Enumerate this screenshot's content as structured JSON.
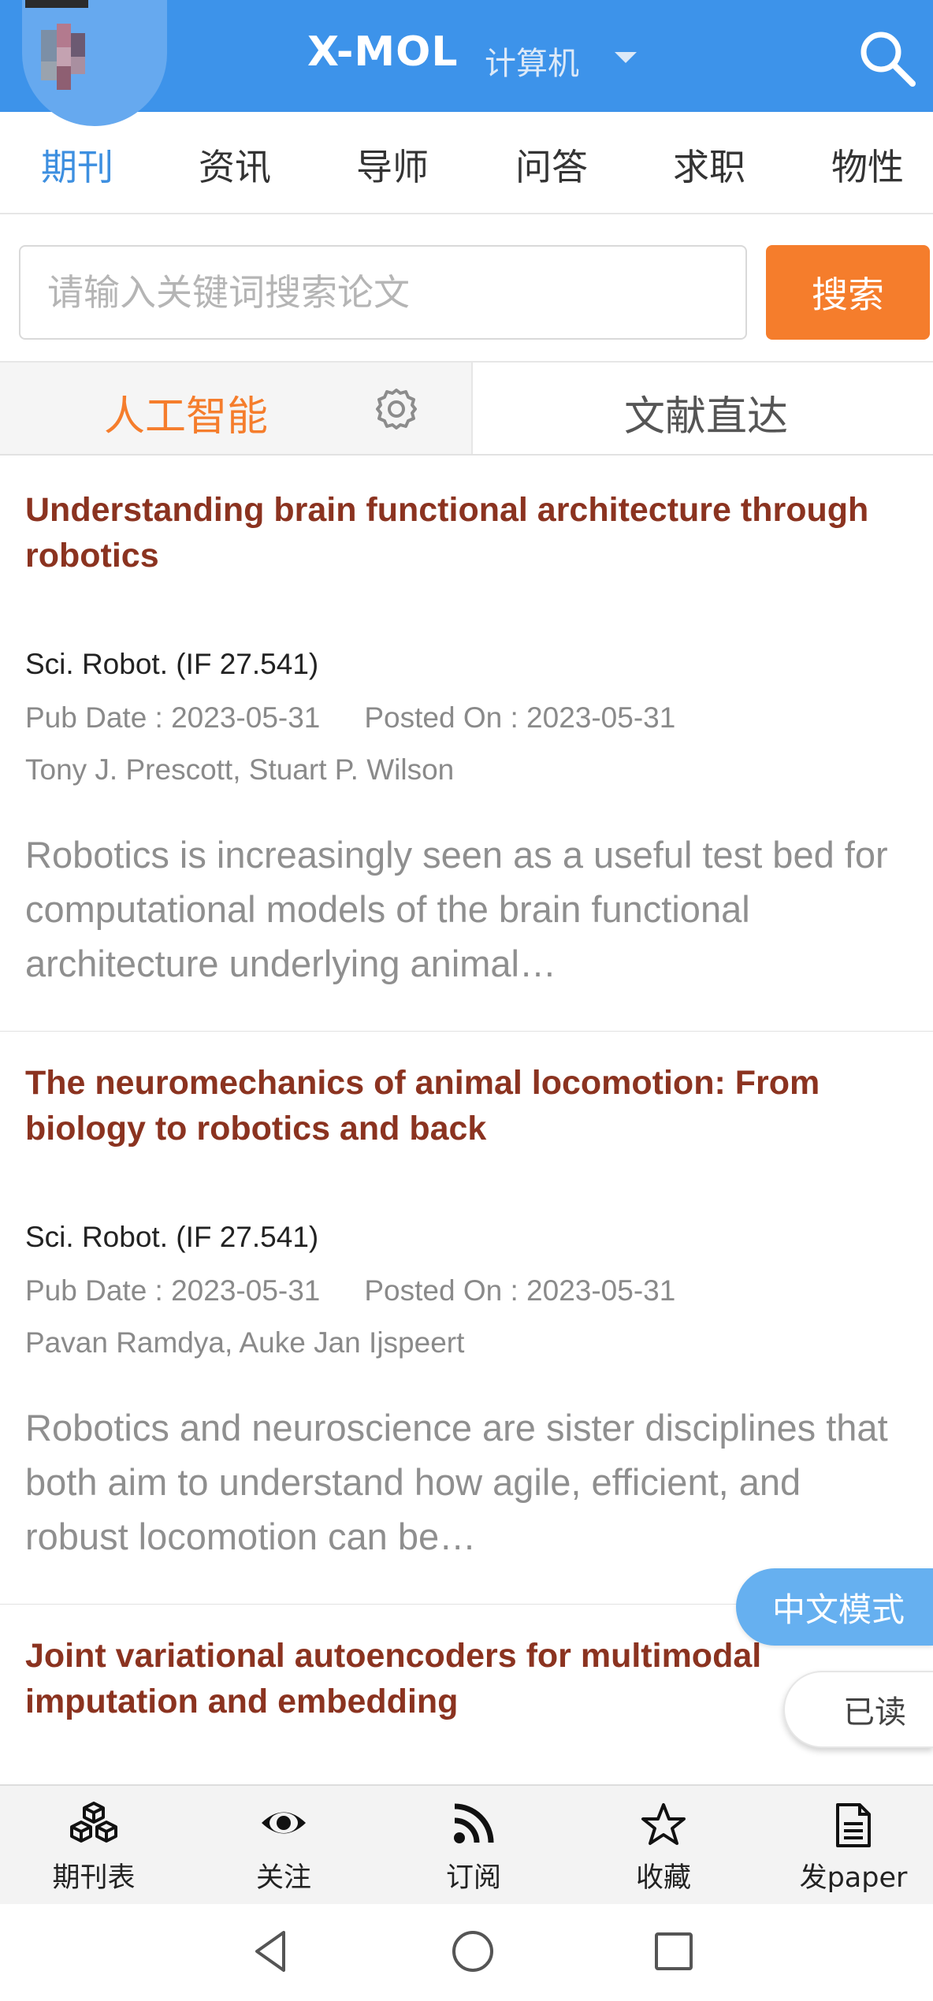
{
  "header": {
    "brand": "X-MOL",
    "category": "计算机",
    "icons": {
      "avatar": "avatar-image",
      "search": "search-icon",
      "dropdown": "caret-down-icon"
    },
    "colors": {
      "bar": "#3d93ea"
    }
  },
  "nav": {
    "items": [
      {
        "label": "期刊",
        "active": true
      },
      {
        "label": "资讯"
      },
      {
        "label": "导师"
      },
      {
        "label": "问答"
      },
      {
        "label": "求职"
      },
      {
        "label": "物性"
      }
    ]
  },
  "search": {
    "placeholder": "请输入关键词搜索论文",
    "button": "搜索",
    "button_color": "#f57d2c"
  },
  "subtabs": {
    "left": "人工智能",
    "right": "文献直达",
    "settings_icon": "gear-icon"
  },
  "articles": [
    {
      "title": "Understanding brain functional architecture through robotics",
      "journal": "Sci. Robot. (IF 27.541)",
      "pub_date": "Pub Date : 2023-05-31",
      "posted_on": "Posted On : 2023-05-31",
      "authors": "Tony J. Prescott, Stuart P. Wilson",
      "abstract": "Robotics is increasingly seen as a useful test bed for computational models of the brain functional architecture underlying animal…"
    },
    {
      "title": "The neuromechanics of animal locomotion: From biology to robotics and back",
      "journal": "Sci. Robot. (IF 27.541)",
      "pub_date": "Pub Date : 2023-05-31",
      "posted_on": "Posted On : 2023-05-31",
      "authors": "Pavan Ramdya, Auke Jan Ijspeert",
      "abstract": "Robotics and neuroscience are sister disciplines that both aim to understand how agile, efficient, and robust locomotion can be…"
    },
    {
      "title": "Joint variational autoencoders for multimodal imputation and embedding"
    }
  ],
  "floating": {
    "chinese_mode": "中文模式",
    "read": "已读"
  },
  "tabbar": {
    "items": [
      {
        "label": "期刊表",
        "icon": "cubes-icon"
      },
      {
        "label": "关注",
        "icon": "eye-icon"
      },
      {
        "label": "订阅",
        "icon": "rss-icon"
      },
      {
        "label": "收藏",
        "icon": "star-icon"
      },
      {
        "label": "发paper",
        "icon": "document-icon"
      }
    ]
  },
  "system_nav": {
    "icons": [
      "back-icon",
      "home-icon",
      "recents-icon"
    ]
  }
}
